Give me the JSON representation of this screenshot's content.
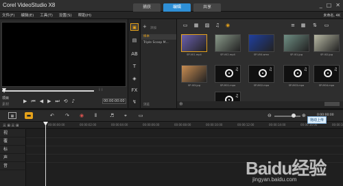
{
  "app": {
    "title": "Corel VideoStudio X8",
    "steps": [
      "捕获",
      "编辑",
      "共享"
    ],
    "active_step": 1,
    "window_controls": [
      "_",
      "□",
      "✕"
    ]
  },
  "menu": {
    "items": [
      "文件(F)",
      "编辑(E)",
      "工具(T)",
      "设置(S)",
      "帮助(H)"
    ],
    "account": "未命名, 4K"
  },
  "player": {
    "mode_label": "项目",
    "mode_sub": "素材",
    "transport_icons": [
      "play-icon",
      "go-start-icon",
      "prev-frame-icon",
      "next-frame-icon",
      "go-end-icon",
      "repeat-icon",
      "volume-icon"
    ],
    "timecode": "00:00:00:00"
  },
  "library": {
    "add_label": "添加",
    "folders": [
      "样本",
      "Triple Scoop M..."
    ],
    "selected_folder": 0,
    "browse_label": "浏览",
    "thumbnails": [
      {
        "label": "SP-V01.mp4",
        "kind": "video",
        "color": "#6a5fae"
      },
      {
        "label": "SP-V02.mp4",
        "kind": "video",
        "color": "#8a9a8a"
      },
      {
        "label": "SP-V04.wmv",
        "kind": "video",
        "color": "#1f3f9e"
      },
      {
        "label": "SP-I01.jpg",
        "kind": "image",
        "color": "#6f8f84"
      },
      {
        "label": "SP-I02.jpg",
        "kind": "image",
        "color": "#b8b9a4"
      },
      {
        "label": "SP-I03.jpg",
        "kind": "image",
        "color": "#c98d52"
      },
      {
        "label": "SP-M01.mpa",
        "kind": "music"
      },
      {
        "label": "SP-M02.mpa",
        "kind": "music"
      },
      {
        "label": "SP-M03.mpa",
        "kind": "music"
      },
      {
        "label": "SP-M04.mpa",
        "kind": "music"
      },
      {
        "label": "SP-M05.mpa",
        "kind": "music"
      }
    ],
    "selected_thumb": 0
  },
  "timeline": {
    "timecode": "0:00:00:00",
    "ruler": [
      "00:00:00:00",
      "00:00:02:00",
      "00:00:04:00",
      "00:00:06:00",
      "00:00:08:00",
      "00:00:10:00",
      "00:00:12:00",
      "00:00:14:00",
      "00:00:16:00",
      "00:00:18:00"
    ],
    "tracks": [
      "视",
      "覆",
      "标",
      "声",
      "音"
    ],
    "track_ctrl_label": "三 ⊞ 三 ⊞"
  },
  "tooltip": "拖动上传",
  "watermark": {
    "text": "Baidu经验",
    "sub": "jingyan.baidu.com"
  }
}
